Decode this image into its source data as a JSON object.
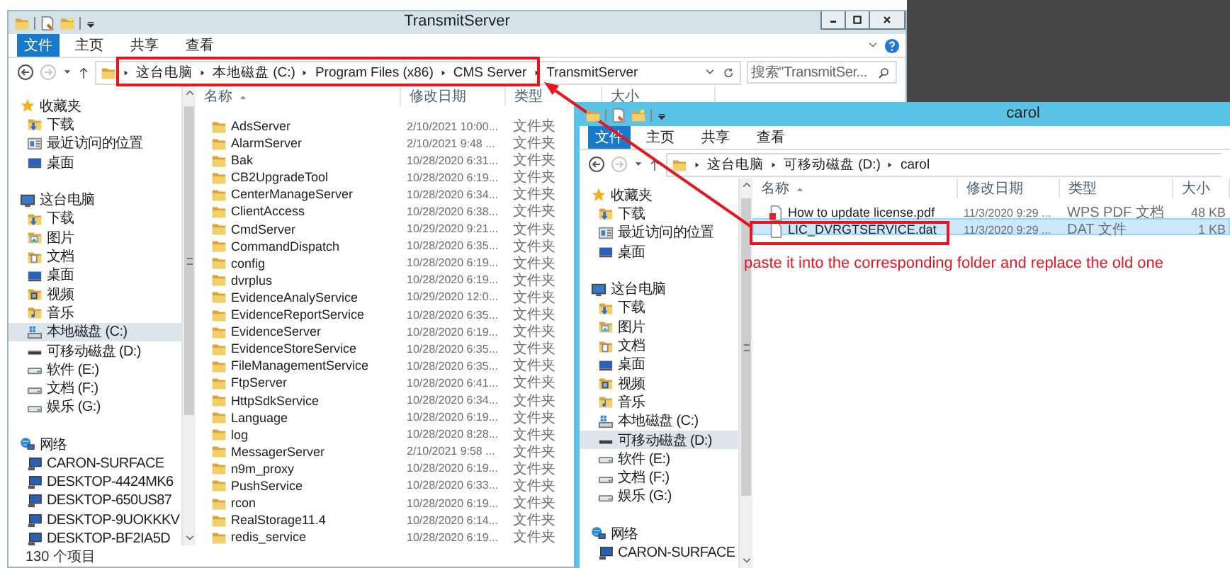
{
  "windows": [
    {
      "title": "TransmitServer",
      "active": false,
      "ribbon": {
        "file_tab": "文件",
        "tabs": [
          "主页",
          "共享",
          "查看"
        ]
      },
      "address": {
        "nav_buttons": [
          {
            "kind": "back",
            "disabled": false
          },
          {
            "kind": "forward",
            "disabled": true
          },
          {
            "kind": "recent",
            "disabled": false
          },
          {
            "kind": "up",
            "disabled": false
          }
        ],
        "path": [
          "这台电脑",
          "本地磁盘 (C:)",
          "Program Files (x86)",
          "CMS Server",
          "TransmitServer"
        ]
      },
      "search": {
        "placeholder": "搜索\"TransmitSer..."
      },
      "nav": [
        {
          "label": "收藏夹",
          "kind": "star",
          "selected": false,
          "children": [
            {
              "label": "下载",
              "kind": "download",
              "selected": false
            },
            {
              "label": "最近访问的位置",
              "kind": "recent",
              "selected": false
            },
            {
              "label": "桌面",
              "kind": "desktop",
              "selected": false
            }
          ]
        },
        {
          "label": "这台电脑",
          "kind": "pc",
          "selected": false,
          "children": [
            {
              "label": "下载",
              "kind": "download",
              "selected": false
            },
            {
              "label": "图片",
              "kind": "pictures",
              "selected": false
            },
            {
              "label": "文档",
              "kind": "documents",
              "selected": false
            },
            {
              "label": "桌面",
              "kind": "desktop",
              "selected": false
            },
            {
              "label": "视频",
              "kind": "video",
              "selected": false
            },
            {
              "label": "音乐",
              "kind": "music",
              "selected": false
            },
            {
              "label": "本地磁盘 (C:)",
              "kind": "system-drive",
              "selected": true
            },
            {
              "label": "可移动磁盘 (D:)",
              "kind": "removable-drive",
              "selected": false
            },
            {
              "label": "软件 (E:)",
              "kind": "drive",
              "selected": false
            },
            {
              "label": "文档 (F:)",
              "kind": "drive",
              "selected": false
            },
            {
              "label": "娱乐 (G:)",
              "kind": "drive",
              "selected": false
            }
          ]
        },
        {
          "label": "网络",
          "kind": "network",
          "selected": false,
          "children": [
            {
              "label": "CARON-SURFACE",
              "kind": "computer",
              "selected": false
            },
            {
              "label": "DESKTOP-4424MK6",
              "kind": "computer",
              "selected": false
            },
            {
              "label": "DESKTOP-650US87",
              "kind": "computer",
              "selected": false
            },
            {
              "label": "DESKTOP-9UOKKKV",
              "kind": "computer",
              "selected": false
            },
            {
              "label": "DESKTOP-BF2IA5D",
              "kind": "computer",
              "selected": false
            }
          ]
        }
      ],
      "columns": [
        "名称",
        "修改日期",
        "类型",
        "大小"
      ],
      "rows": [
        {
          "name": "AdsServer",
          "modified": "2/10/2021 10:00...",
          "type": "文件夹",
          "kind": "folder",
          "selected": false
        },
        {
          "name": "AlarmServer",
          "modified": "2/10/2021 9:48 ...",
          "type": "文件夹",
          "kind": "folder",
          "selected": false
        },
        {
          "name": "Bak",
          "modified": "10/28/2020 6:31...",
          "type": "文件夹",
          "kind": "folder",
          "selected": false
        },
        {
          "name": "CB2UpgradeTool",
          "modified": "10/28/2020 6:19...",
          "type": "文件夹",
          "kind": "folder",
          "selected": false
        },
        {
          "name": "CenterManageServer",
          "modified": "10/28/2020 6:34...",
          "type": "文件夹",
          "kind": "folder",
          "selected": false
        },
        {
          "name": "ClientAccess",
          "modified": "10/28/2020 6:38...",
          "type": "文件夹",
          "kind": "folder",
          "selected": false
        },
        {
          "name": "CmdServer",
          "modified": "10/29/2020 9:21...",
          "type": "文件夹",
          "kind": "folder",
          "selected": false
        },
        {
          "name": "CommandDispatch",
          "modified": "10/28/2020 6:35...",
          "type": "文件夹",
          "kind": "folder",
          "selected": false
        },
        {
          "name": "config",
          "modified": "10/28/2020 6:19...",
          "type": "文件夹",
          "kind": "folder",
          "selected": false
        },
        {
          "name": "dvrplus",
          "modified": "10/28/2020 6:19...",
          "type": "文件夹",
          "kind": "folder",
          "selected": false
        },
        {
          "name": "EvidenceAnalyService",
          "modified": "10/29/2020 12:0...",
          "type": "文件夹",
          "kind": "folder",
          "selected": false
        },
        {
          "name": "EvidenceReportService",
          "modified": "10/28/2020 6:35...",
          "type": "文件夹",
          "kind": "folder",
          "selected": false
        },
        {
          "name": "EvidenceServer",
          "modified": "10/28/2020 6:19...",
          "type": "文件夹",
          "kind": "folder",
          "selected": false
        },
        {
          "name": "EvidenceStoreService",
          "modified": "10/28/2020 6:35...",
          "type": "文件夹",
          "kind": "folder",
          "selected": false
        },
        {
          "name": "FileManagementService",
          "modified": "10/28/2020 6:35...",
          "type": "文件夹",
          "kind": "folder",
          "selected": false
        },
        {
          "name": "FtpServer",
          "modified": "10/28/2020 6:41...",
          "type": "文件夹",
          "kind": "folder",
          "selected": false
        },
        {
          "name": "HttpSdkService",
          "modified": "10/28/2020 6:34...",
          "type": "文件夹",
          "kind": "folder",
          "selected": false
        },
        {
          "name": "Language",
          "modified": "10/28/2020 6:19...",
          "type": "文件夹",
          "kind": "folder",
          "selected": false
        },
        {
          "name": "log",
          "modified": "10/28/2020 8:28...",
          "type": "文件夹",
          "kind": "folder",
          "selected": false
        },
        {
          "name": "MessagerServer",
          "modified": "2/10/2021 9:58 ...",
          "type": "文件夹",
          "kind": "folder",
          "selected": false
        },
        {
          "name": "n9m_proxy",
          "modified": "10/28/2020 6:19...",
          "type": "文件夹",
          "kind": "folder",
          "selected": false
        },
        {
          "name": "PushService",
          "modified": "10/28/2020 6:33...",
          "type": "文件夹",
          "kind": "folder",
          "selected": false
        },
        {
          "name": "rcon",
          "modified": "10/28/2020 6:19...",
          "type": "文件夹",
          "kind": "folder",
          "selected": false
        },
        {
          "name": "RealStorage11.4",
          "modified": "10/28/2020 6:14...",
          "type": "文件夹",
          "kind": "folder",
          "selected": false
        },
        {
          "name": "redis_service",
          "modified": "10/28/2020 6:19...",
          "type": "文件夹",
          "kind": "folder",
          "selected": false
        }
      ],
      "status_bar": "130 个项目"
    },
    {
      "title": "carol",
      "active": true,
      "ribbon": {
        "file_tab": "文件",
        "tabs": [
          "主页",
          "共享",
          "查看"
        ]
      },
      "address": {
        "nav_buttons": [
          {
            "kind": "back",
            "disabled": false
          },
          {
            "kind": "forward",
            "disabled": true
          },
          {
            "kind": "recent",
            "disabled": false
          },
          {
            "kind": "up",
            "disabled": false
          }
        ],
        "path": [
          "这台电脑",
          "可移动磁盘 (D:)",
          "carol"
        ]
      },
      "nav": [
        {
          "label": "收藏夹",
          "kind": "star",
          "selected": false,
          "children": [
            {
              "label": "下载",
              "kind": "download",
              "selected": false
            },
            {
              "label": "最近访问的位置",
              "kind": "recent",
              "selected": false
            },
            {
              "label": "桌面",
              "kind": "desktop",
              "selected": false
            }
          ]
        },
        {
          "label": "这台电脑",
          "kind": "pc",
          "selected": false,
          "children": [
            {
              "label": "下载",
              "kind": "download",
              "selected": false
            },
            {
              "label": "图片",
              "kind": "pictures",
              "selected": false
            },
            {
              "label": "文档",
              "kind": "documents",
              "selected": false
            },
            {
              "label": "桌面",
              "kind": "desktop",
              "selected": false
            },
            {
              "label": "视频",
              "kind": "video",
              "selected": false
            },
            {
              "label": "音乐",
              "kind": "music",
              "selected": false
            },
            {
              "label": "本地磁盘 (C:)",
              "kind": "system-drive",
              "selected": false
            },
            {
              "label": "可移动磁盘 (D:)",
              "kind": "removable-drive",
              "selected": true
            },
            {
              "label": "软件 (E:)",
              "kind": "drive",
              "selected": false
            },
            {
              "label": "文档 (F:)",
              "kind": "drive",
              "selected": false
            },
            {
              "label": "娱乐 (G:)",
              "kind": "drive",
              "selected": false
            }
          ]
        },
        {
          "label": "网络",
          "kind": "network",
          "selected": false,
          "children": [
            {
              "label": "CARON-SURFACE",
              "kind": "computer",
              "selected": false
            }
          ]
        }
      ],
      "columns": [
        "名称",
        "修改日期",
        "类型",
        "大小"
      ],
      "rows": [
        {
          "name": "How to update license.pdf",
          "modified": "11/3/2020 9:29 ...",
          "type": "WPS PDF 文档",
          "size": "48 KB",
          "kind": "pdf",
          "selected": false
        },
        {
          "name": "LIC_DVRGTSERVICE.dat",
          "modified": "11/3/2020 9:29 ...",
          "type": "DAT 文件",
          "size": "1 KB",
          "kind": "file",
          "selected": true
        }
      ]
    }
  ],
  "annotation": {
    "note": "paste it into the corresponding folder and replace the old one"
  }
}
